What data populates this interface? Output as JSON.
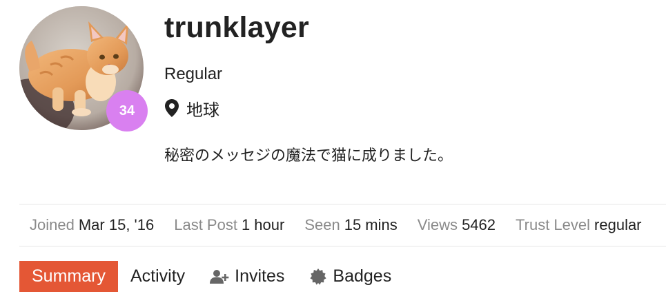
{
  "user": {
    "username": "trunklayer",
    "title": "Regular",
    "location": "地球",
    "bio": "秘密のメッセジの魔法で猫に成りました。",
    "level": "34",
    "level_badge_color": "#d980f0",
    "location_icon": "map-marker-icon"
  },
  "stats": [
    {
      "label": "Joined",
      "value": "Mar 15, '16"
    },
    {
      "label": "Last Post",
      "value": "1 hour"
    },
    {
      "label": "Seen",
      "value": "15 mins"
    },
    {
      "label": "Views",
      "value": "5462"
    },
    {
      "label": "Trust Level",
      "value": "regular"
    }
  ],
  "nav": {
    "active_color": "#e45735",
    "tabs": [
      {
        "label": "Summary",
        "active": true,
        "icon": ""
      },
      {
        "label": "Activity",
        "active": false,
        "icon": ""
      },
      {
        "label": "Invites",
        "active": false,
        "icon": "user-plus-icon"
      },
      {
        "label": "Badges",
        "active": false,
        "icon": "badge-certificate-icon"
      }
    ]
  }
}
